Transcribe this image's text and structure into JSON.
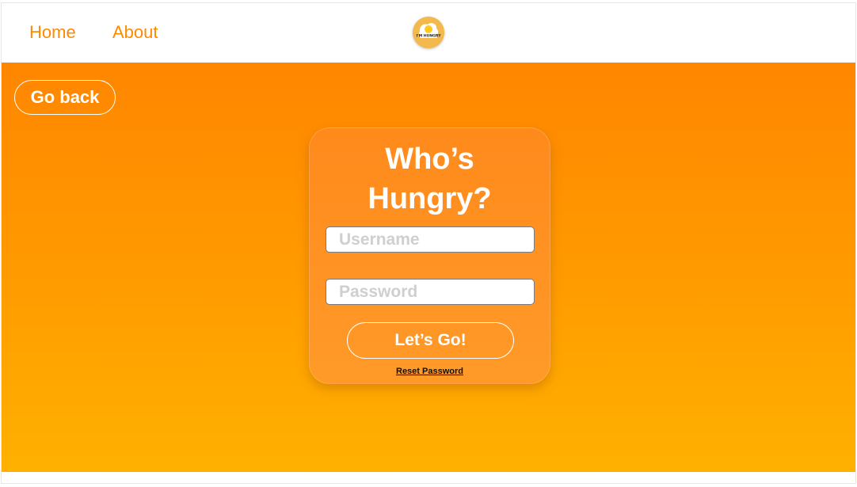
{
  "nav": {
    "home_label": "Home",
    "about_label": "About",
    "logo_text": "I'M HUNGRY"
  },
  "hero": {
    "back_label": "Go back"
  },
  "login": {
    "title": "Who’s\nHungry?",
    "username_placeholder": "Username",
    "username_value": "",
    "password_placeholder": "Password",
    "password_value": "",
    "submit_label": "Let’s Go!",
    "reset_label": "Reset Password"
  },
  "colors": {
    "accent": "#ff8a00",
    "gradient_top": "#ff8600",
    "gradient_bottom": "#ffb100",
    "text_on_accent": "#ffffff"
  },
  "icons": {
    "logo": "fried-egg-logo-icon"
  }
}
